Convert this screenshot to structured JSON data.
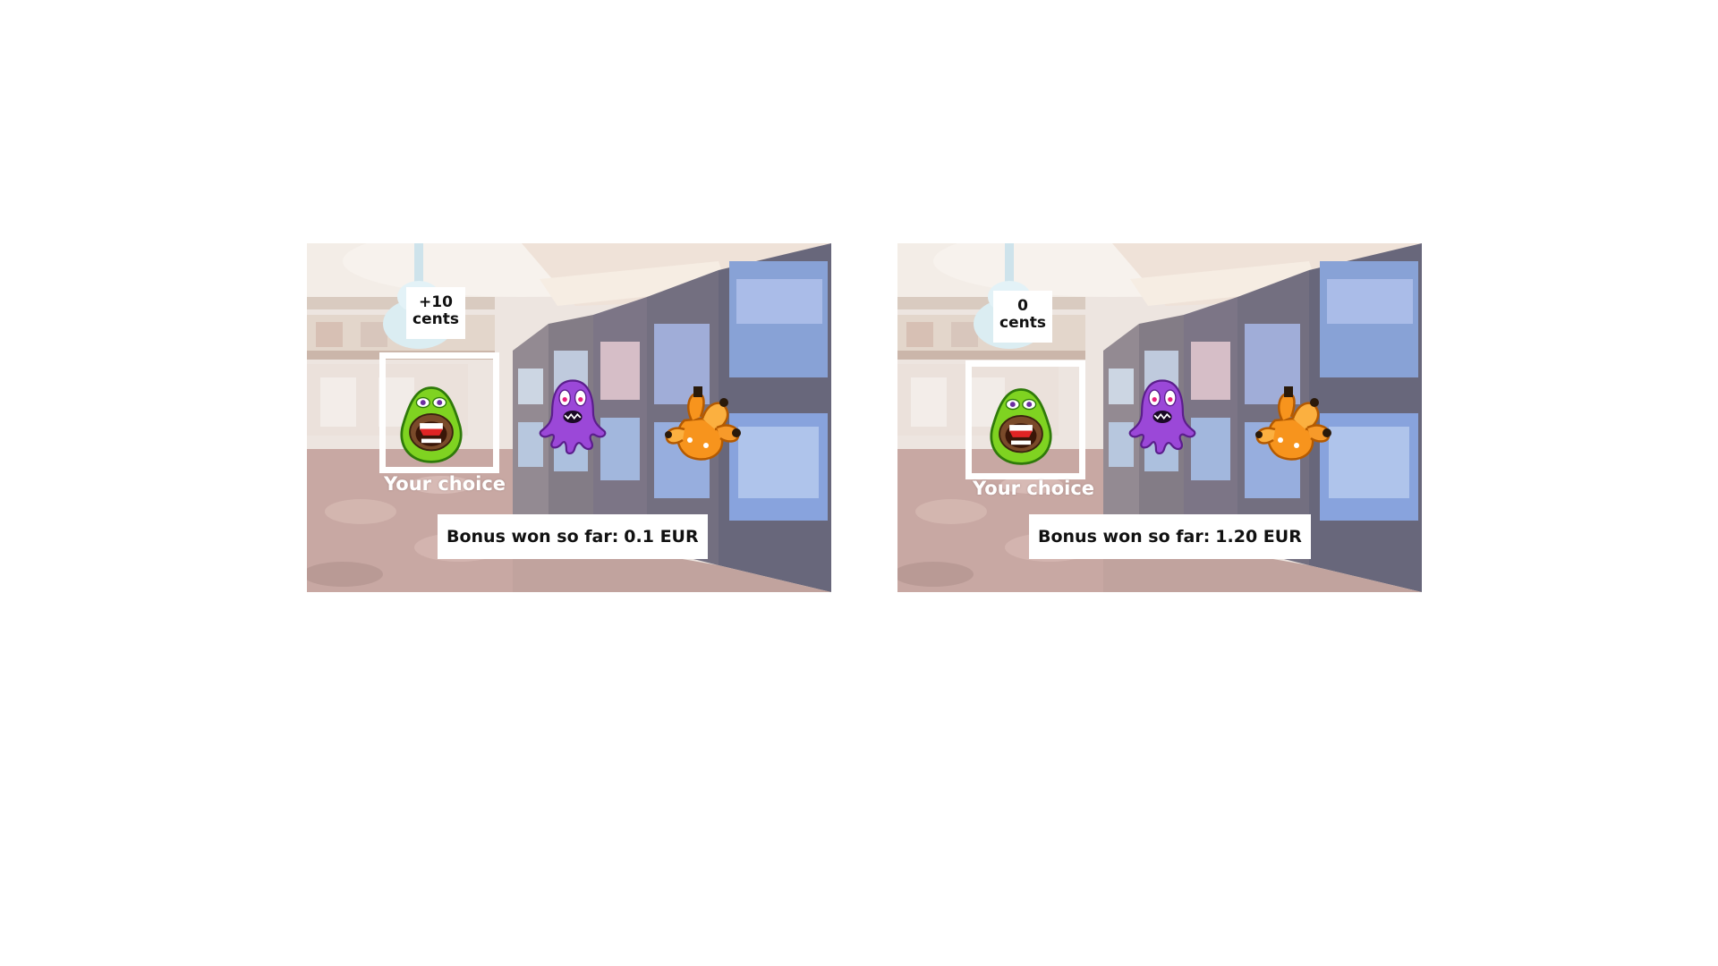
{
  "trials": [
    {
      "reward_value": "+10",
      "reward_unit": "cents",
      "choice_label": "Your choice",
      "bonus_label": "Bonus won so far:",
      "bonus_value": "0.1 EUR"
    },
    {
      "reward_value": "0",
      "reward_unit": "cents",
      "choice_label": "Your choice",
      "bonus_label": "Bonus won so far:",
      "bonus_value": "1.20 EUR"
    }
  ],
  "options": [
    {
      "name": "green-avocado-monster",
      "color": "#7fd321"
    },
    {
      "name": "purple-octopus-monster",
      "color": "#9b48d8"
    },
    {
      "name": "orange-multi-head-monster",
      "color": "#f7941d"
    }
  ],
  "background": {
    "scene": "casino-slot-machines",
    "carpet_color": "#b7847f",
    "wall_color": "#e8ddd6"
  }
}
